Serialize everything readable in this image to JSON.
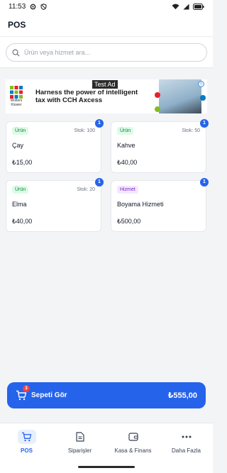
{
  "status_bar": {
    "time": "11:53"
  },
  "header": {
    "title": "POS"
  },
  "search": {
    "placeholder": "Ürün veya hizmet ara..."
  },
  "ad": {
    "label": "Test Ad",
    "logo_text": "Wolters Kluwer",
    "headline_line1": "Harness the power of intelligent",
    "headline_line2": "tax with CCH Axcess",
    "info": "i"
  },
  "products": [
    {
      "type_label": "Ürün",
      "type": "urun",
      "stock": "Stok: 100",
      "name": "Çay",
      "price": "₺15,00",
      "count": "1"
    },
    {
      "type_label": "Ürün",
      "type": "urun",
      "stock": "Stok: 50",
      "name": "Kahve",
      "price": "₺40,00",
      "count": "1"
    },
    {
      "type_label": "Ürün",
      "type": "urun",
      "stock": "Stok: 20",
      "name": "Elma",
      "price": "₺40,00",
      "count": "1"
    },
    {
      "type_label": "Hizmet",
      "type": "hizmet",
      "stock": "",
      "name": "Boyama Hizmeti",
      "price": "₺500,00",
      "count": "1"
    }
  ],
  "cart": {
    "label": "Sepeti Gör",
    "count": "3",
    "total": "₺555,00"
  },
  "nav": [
    {
      "label": "POS",
      "icon": "cart-icon",
      "active": true
    },
    {
      "label": "Siparişler",
      "icon": "document-icon",
      "active": false
    },
    {
      "label": "Kasa & Finans",
      "icon": "wallet-icon",
      "active": false
    },
    {
      "label": "Daha Fazla",
      "icon": "more-icon",
      "active": false
    }
  ],
  "colors": {
    "accent": "#2563eb",
    "tag_product": "#15803d",
    "tag_service": "#7e22ce",
    "badge": "#ef4444"
  }
}
